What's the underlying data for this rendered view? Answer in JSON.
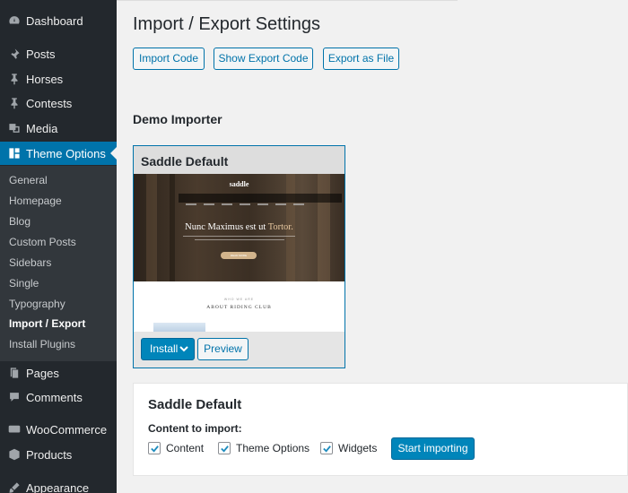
{
  "sidebar": {
    "top_items": [
      {
        "label": "Dashboard",
        "icon": "dashboard-icon"
      },
      {
        "label": "Posts",
        "icon": "pin-icon"
      },
      {
        "label": "Horses",
        "icon": "pin-icon"
      },
      {
        "label": "Contests",
        "icon": "pin-icon"
      },
      {
        "label": "Media",
        "icon": "media-icon"
      },
      {
        "label": "Theme Options",
        "icon": "grid-icon"
      }
    ],
    "submenu": [
      "General",
      "Homepage",
      "Blog",
      "Custom Posts",
      "Sidebars",
      "Single",
      "Typography",
      "Import / Export",
      "Install Plugins"
    ],
    "bottom_items": [
      {
        "label": "Pages",
        "icon": "pages-icon"
      },
      {
        "label": "Comments",
        "icon": "comment-icon"
      },
      {
        "label": "WooCommerce",
        "icon": "woocommerce-icon"
      },
      {
        "label": "Products",
        "icon": "products-icon"
      },
      {
        "label": "Appearance",
        "icon": "appearance-icon"
      }
    ],
    "current": "Theme Options",
    "active_sub": "Import / Export"
  },
  "page": {
    "title": "Import / Export Settings",
    "buttons": [
      "Import Code",
      "Show Export Code",
      "Export as File"
    ],
    "demo_section_title": "Demo Importer"
  },
  "card": {
    "title": "Saddle Default",
    "preview": {
      "logo": "saddle",
      "headline_a": "Nunc Maximus est ut ",
      "headline_b": "Tortor.",
      "cta": "READ MORE",
      "eyebrow": "WHO WE ARE",
      "subtitle": "ABOUT RIDING CLUB"
    },
    "install_label": "Install",
    "preview_label": "Preview"
  },
  "import_panel": {
    "title": "Saddle Default",
    "content_label": "Content to import:",
    "options": [
      {
        "label": "Content",
        "checked": true
      },
      {
        "label": "Theme Options",
        "checked": true
      },
      {
        "label": "Widgets",
        "checked": true
      }
    ],
    "start_label": "Start importing"
  },
  "colors": {
    "sidebar_bg": "#23282d",
    "submenu_bg": "#32373c",
    "accent": "#0073aa",
    "primary_button": "#0085ba"
  }
}
